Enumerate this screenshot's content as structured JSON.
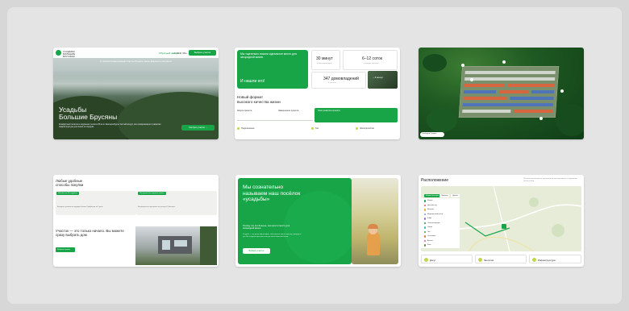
{
  "hero": {
    "brand": "УСАДЬБЫ БОЛЬШИЕ БРУСЯНЫ",
    "menu": "О посёлке   Коммуникации   Участки   Проекты   Цены   Документы   Контакты",
    "phone_note": "Обратный звонок",
    "phone": "+7 (343) 361-...",
    "cta": "Выбрать участок",
    "title_line1": "Усадьбы",
    "title_line2": "Большие Брусяны",
    "description": "Комфортный посёлок в окружении лесов в 25 км от Екатеринбурга. Чистый воздух, все коммуникации и развитая инфраструктура для жизни за городом.",
    "button": "Смотреть участки  →"
  },
  "intro": {
    "green_text": "Мы тщательно искали идеальное место для загородной жизни",
    "green_big": "И нашли его!",
    "stats": [
      {
        "value": "30 минут",
        "label": "до Екатеринбурга"
      },
      {
        "value": "6–12 соток",
        "label": "площадь участков"
      },
      {
        "value": "347 домовладений",
        "label": "в посёлке"
      },
      {
        "value": "~ 3 минут",
        "label": "до озера"
      }
    ],
    "heading_line1": "Новый формат",
    "heading_line2": "высокого качества жизни",
    "col_a": "Запуск проекта",
    "col_b": "Завершение проекта",
    "green_card_title": "Этап развития проекта",
    "foot": [
      "Подключение",
      "Газ",
      "Электричество"
    ]
  },
  "masterplan": {
    "legend": "Свободен   Продан"
  },
  "purchase": {
    "title_line1": "Любые удобные",
    "title_line2": "способы покупки",
    "tag1": "Ипотека от 6% годовых",
    "tag2": "Рассрочка без первого взноса",
    "text1": "Выгодные условия от ведущих банков. Одобрение за 1 день.",
    "text2": "Беспроцентная рассрочка на срок до 12 месяцев.",
    "title2": "Участок — это только начало. Вы можете сразу выбрать дом",
    "button": "Выбрать проект"
  },
  "about": {
    "title_line1": "Мы сознательно",
    "title_line2": "называем наш посёлок",
    "title_line3": "«усадьбы»",
    "para1": "Потому что это больше, чем просто место для загородной жизни",
    "para2": "Усадьба — это целая философия: собственная земля, простор, природа и уют. Мы создаём пространство для жизни большой семьи.",
    "button": "Выбрать участок"
  },
  "location": {
    "title": "Расположение",
    "subtitle": "Посёлок расположен в экологически чистом районе, в окружении лесов и озёр",
    "tabs": [
      "Инфраструктура",
      "Природа",
      "Дороги"
    ],
    "list": [
      {
        "label": "Школа",
        "color": "#17a548"
      },
      {
        "label": "Детский сад",
        "color": "#e05a5a"
      },
      {
        "label": "Магазин",
        "color": "#f0a43b"
      },
      {
        "label": "Медицинский центр",
        "color": "#5aa9e0"
      },
      {
        "label": "Кафе",
        "color": "#9a6ee0"
      },
      {
        "label": "Спортплощадка",
        "color": "#17a548"
      },
      {
        "label": "Озеро",
        "color": "#3fb6c8"
      },
      {
        "label": "Лес",
        "color": "#4e9a3a"
      },
      {
        "label": "Остановка",
        "color": "#e07a3a"
      },
      {
        "label": "Аптека",
        "color": "#e05a9a"
      },
      {
        "label": "Банк",
        "color": "#6a8a3a"
      }
    ],
    "bottom": [
      "Досуг",
      "Экология",
      "Инфраструктура"
    ]
  }
}
